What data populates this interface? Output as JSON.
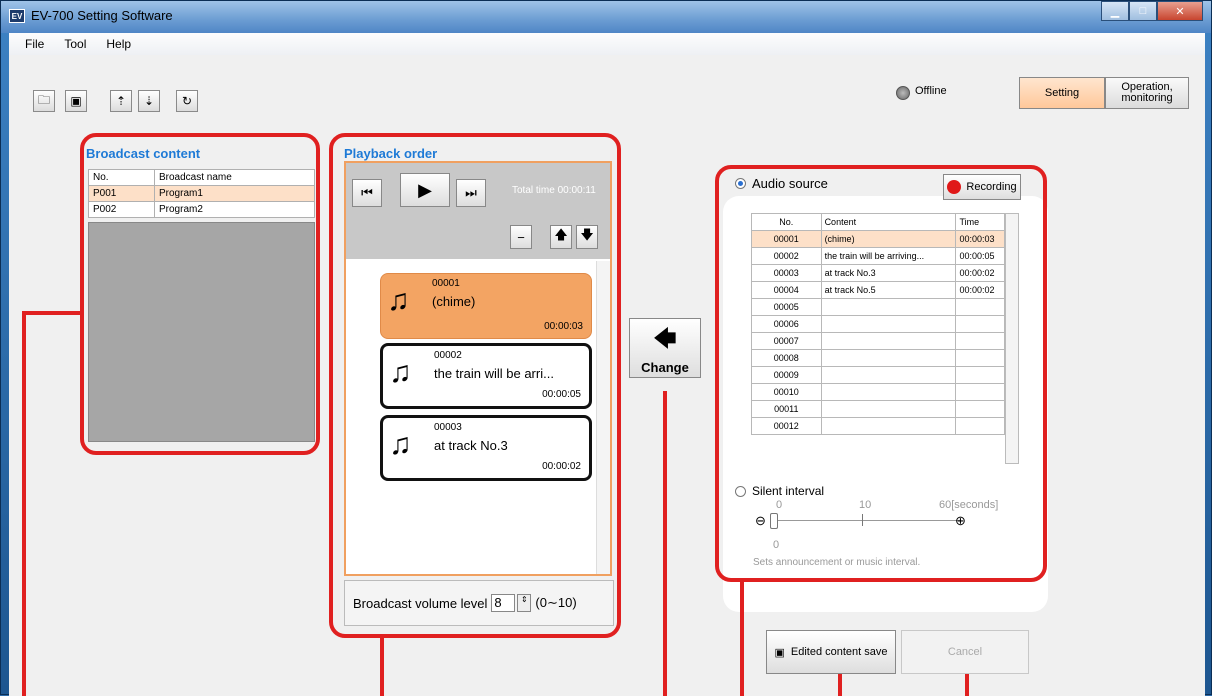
{
  "window": {
    "title": "EV-700 Setting Software",
    "icon_text": "EV"
  },
  "menu": [
    "File",
    "Tool",
    "Help"
  ],
  "status": {
    "text": "Offline"
  },
  "mode_tabs": {
    "setting": "Setting",
    "operation": "Operation,",
    "operation2": "monitoring"
  },
  "broadcast": {
    "title": "Broadcast content",
    "col_no": "No.",
    "col_name": "Broadcast name",
    "rows": [
      {
        "no": "P001",
        "name": "Program1"
      },
      {
        "no": "P002",
        "name": "Program2"
      }
    ]
  },
  "playback": {
    "title": "Playback order",
    "total_label": "Total time",
    "total_value": "00:00:11",
    "cards": [
      {
        "no": "00001",
        "content": "(chime)",
        "time": "00:00:03"
      },
      {
        "no": "00002",
        "content": "the train will be arri...",
        "time": "00:00:05"
      },
      {
        "no": "00003",
        "content": "at track No.3",
        "time": "00:00:02"
      }
    ],
    "volume_label": "Broadcast volume level",
    "volume_value": "8",
    "volume_range": "(0∼10)"
  },
  "change_button": "Change",
  "audio": {
    "radio_label": "Audio source",
    "recording_label": "Recording",
    "col_no": "No.",
    "col_content": "Content",
    "col_time": "Time",
    "rows": [
      {
        "no": "00001",
        "content": "(chime)",
        "time": "00:00:03"
      },
      {
        "no": "00002",
        "content": "the train will be arriving...",
        "time": "00:00:05"
      },
      {
        "no": "00003",
        "content": "at track No.3",
        "time": "00:00:02"
      },
      {
        "no": "00004",
        "content": "at track No.5",
        "time": "00:00:02"
      },
      {
        "no": "00005",
        "content": "",
        "time": ""
      },
      {
        "no": "00006",
        "content": "",
        "time": ""
      },
      {
        "no": "00007",
        "content": "",
        "time": ""
      },
      {
        "no": "00008",
        "content": "",
        "time": ""
      },
      {
        "no": "00009",
        "content": "",
        "time": ""
      },
      {
        "no": "00010",
        "content": "",
        "time": ""
      },
      {
        "no": "00011",
        "content": "",
        "time": ""
      },
      {
        "no": "00012",
        "content": "",
        "time": ""
      }
    ],
    "silent_label": "Silent interval",
    "slider_min": "0",
    "slider_mid": "10",
    "slider_max": "60[seconds]",
    "slider_value": "0",
    "hint": "Sets announcement or music interval."
  },
  "save_button": "Edited content save",
  "cancel_button": "Cancel"
}
